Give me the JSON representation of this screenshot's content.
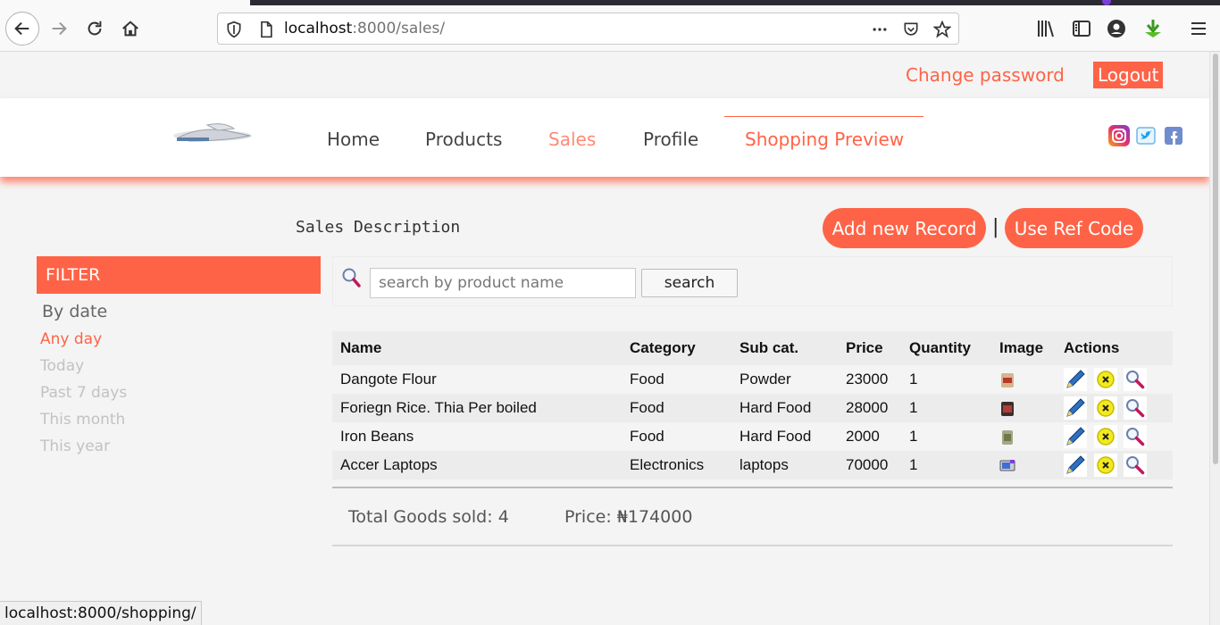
{
  "browser": {
    "url_host": "localhost",
    "url_rest": ":8000/sales/",
    "status_url": "localhost:8000/shopping/"
  },
  "topbar": {
    "change_password": "Change password",
    "logout": "Logout"
  },
  "nav": {
    "items": [
      "Home",
      "Products",
      "Sales",
      "Profile",
      "Shopping Preview"
    ]
  },
  "main": {
    "description": "Sales Description",
    "add_record": "Add new Record",
    "separator": "|",
    "use_ref_code": "Use Ref Code"
  },
  "filter": {
    "title": "FILTER",
    "by_date": "By date",
    "options": [
      "Any day",
      "Today",
      "Past 7 days",
      "This month",
      "This year"
    ]
  },
  "search": {
    "placeholder": "search by product name",
    "button": "search"
  },
  "table": {
    "headers": [
      "Name",
      "Category",
      "Sub cat.",
      "Price",
      "Quantity",
      "Image",
      "Actions"
    ],
    "rows": [
      {
        "name": "Dangote Flour",
        "category": "Food",
        "subcat": "Powder",
        "price": "23000",
        "quantity": "1"
      },
      {
        "name": "Foriegn Rice. Thia Per boiled",
        "category": "Food",
        "subcat": "Hard Food",
        "price": "28000",
        "quantity": "1"
      },
      {
        "name": "Iron Beans",
        "category": "Food",
        "subcat": "Hard Food",
        "price": "2000",
        "quantity": "1"
      },
      {
        "name": "Accer Laptops",
        "category": "Electronics",
        "subcat": "laptops",
        "price": "70000",
        "quantity": "1"
      }
    ]
  },
  "totals": {
    "goods_sold": "Total Goods sold: 4",
    "price": "Price: ₦174000"
  },
  "colors": {
    "accent": "#ff6347",
    "accent_light": "#ff8a73"
  },
  "icons": {
    "row_actions": [
      "pencil-icon",
      "delete-x-icon",
      "view-magnifier-icon"
    ]
  }
}
